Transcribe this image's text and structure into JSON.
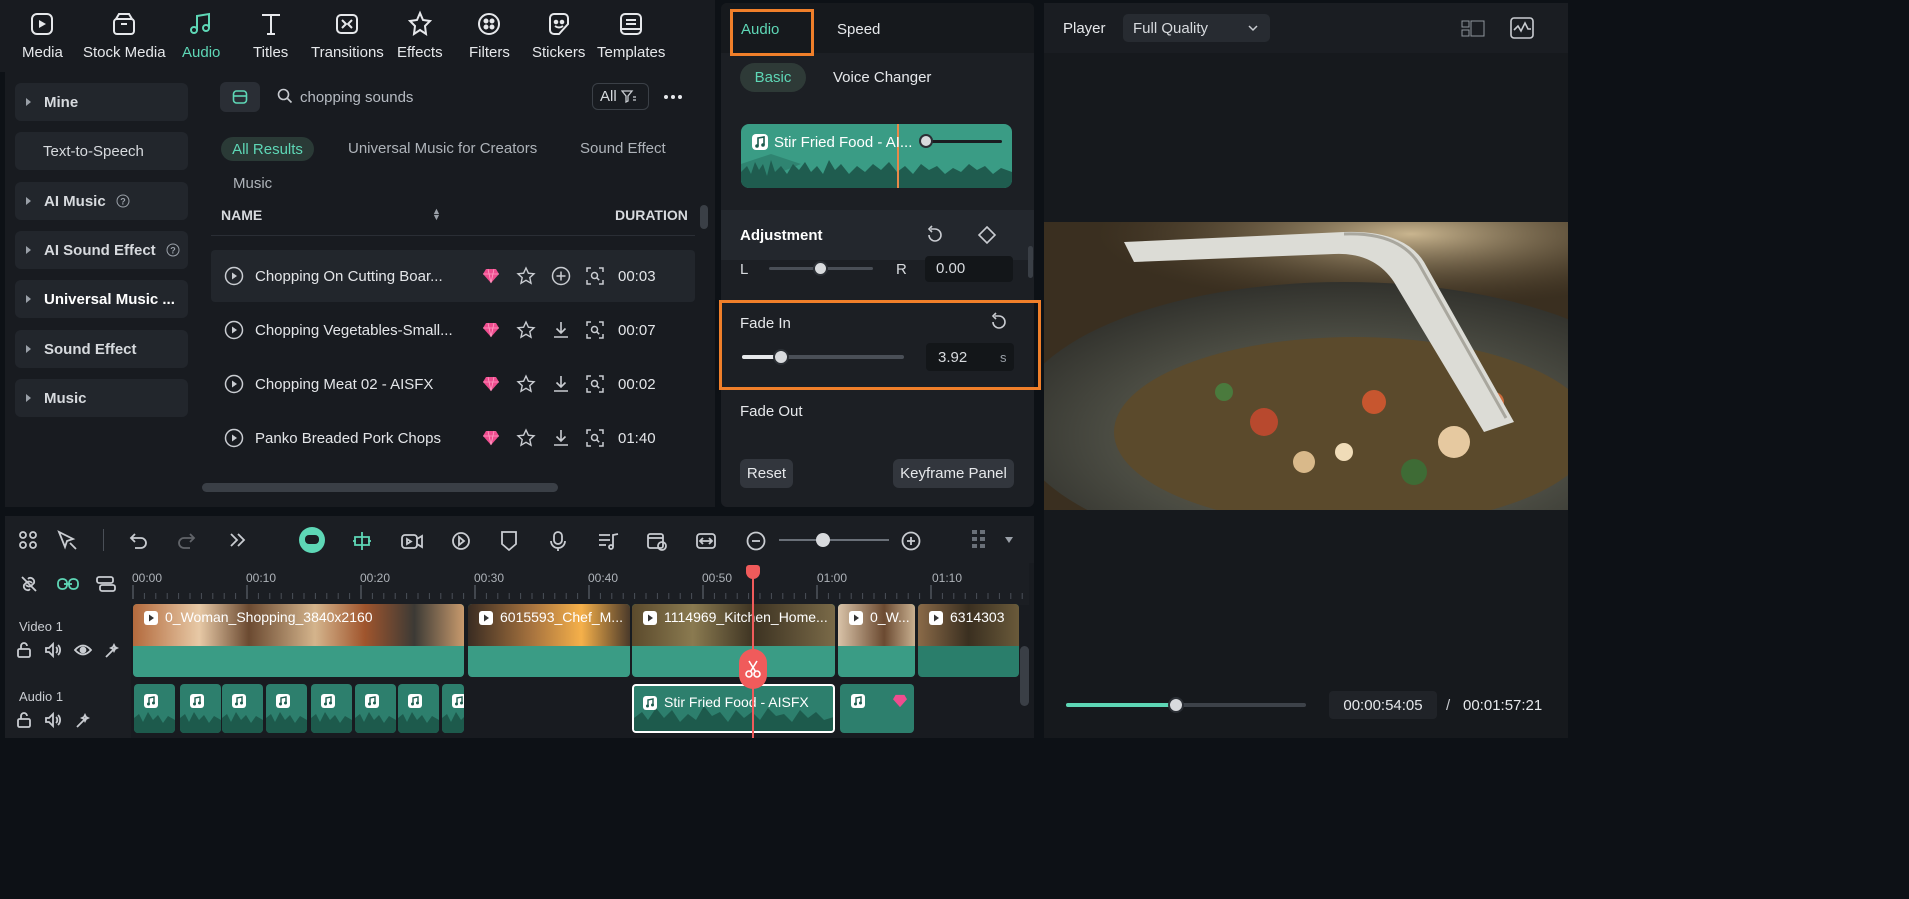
{
  "topbar": {
    "items": [
      {
        "label": "Media",
        "icon": "media-icon"
      },
      {
        "label": "Stock Media",
        "icon": "stock-media-icon"
      },
      {
        "label": "Audio",
        "icon": "audio-icon",
        "active": true
      },
      {
        "label": "Titles",
        "icon": "titles-icon"
      },
      {
        "label": "Transitions",
        "icon": "transitions-icon"
      },
      {
        "label": "Effects",
        "icon": "effects-icon"
      },
      {
        "label": "Filters",
        "icon": "filters-icon"
      },
      {
        "label": "Stickers",
        "icon": "stickers-icon"
      },
      {
        "label": "Templates",
        "icon": "templates-icon"
      }
    ]
  },
  "sidenav": {
    "items": [
      {
        "label": "Mine"
      },
      {
        "label": "Text-to-Speech"
      },
      {
        "label": "AI Music"
      },
      {
        "label": "AI Sound Effect"
      },
      {
        "label": "Universal Music ..."
      },
      {
        "label": "Sound Effect"
      },
      {
        "label": "Music"
      }
    ]
  },
  "browser": {
    "search_value": "chopping sounds",
    "filter_label": "All",
    "result_tabs": [
      "All Results",
      "Universal Music for Creators",
      "Sound Effect",
      "Music"
    ],
    "col_name": "NAME",
    "col_duration": "DURATION",
    "rows": [
      {
        "name": "Chopping On Cutting Boar...",
        "duration": "00:03"
      },
      {
        "name": "Chopping Vegetables-Small...",
        "duration": "00:07"
      },
      {
        "name": "Chopping Meat 02 - AISFX",
        "duration": "00:02"
      },
      {
        "name": "Panko Breaded Pork Chops",
        "duration": "01:40"
      }
    ]
  },
  "props": {
    "tabs": [
      "Audio",
      "Speed"
    ],
    "subtabs": [
      "Basic",
      "Voice Changer"
    ],
    "clip_name": "Stir Fried Food - AI...",
    "adjustment_label": "Adjustment",
    "balance_left": "L",
    "balance_right": "R",
    "balance_value": "0.00",
    "fade_in_label": "Fade In",
    "fade_in_value": "3.92",
    "fade_in_unit": "s",
    "fade_in_fraction": 0.24,
    "fade_out_label": "Fade Out",
    "reset_label": "Reset",
    "keyframe_label": "Keyframe Panel"
  },
  "player": {
    "label": "Player",
    "quality": "Full Quality",
    "current_time": "00:00:54:05",
    "separator": "/",
    "total_time": "00:01:57:21",
    "progress_fraction": 0.46
  },
  "timeline": {
    "ruler": [
      "00:00",
      "00:10",
      "00:20",
      "00:30",
      "00:40",
      "00:50",
      "01:00",
      "01:10"
    ],
    "video_track": "Video 1",
    "audio_track": "Audio 1",
    "video_clips": [
      "0_Woman_Shopping_3840x2160",
      "6015593_Chef_M...",
      "1114969_Kitchen_Home...",
      "0_W...",
      "6314303"
    ],
    "audio_clip": "Stir Fried Food - AISFX"
  },
  "colors": {
    "accent": "#5ed7b6",
    "highlight": "#f07f2a",
    "playhead": "#f05b5b",
    "clip_teal": "#3a9c85"
  }
}
